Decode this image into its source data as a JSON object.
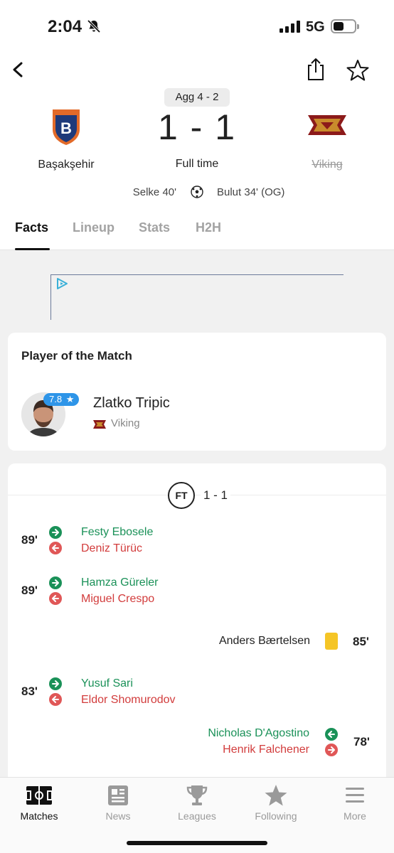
{
  "status_bar": {
    "time": "2:04",
    "network": "5G"
  },
  "header": {
    "aggregate": "Agg 4 - 2",
    "score": "1 - 1",
    "match_status": "Full time",
    "home_team": "Başakşehir",
    "away_team": "Viking",
    "home_scorer": "Selke 40'",
    "away_scorer": "Bulut 34' (OG)"
  },
  "tabs": [
    "Facts",
    "Lineup",
    "Stats",
    "H2H"
  ],
  "player_of_match": {
    "title": "Player of the Match",
    "rating": "7.8",
    "name": "Zlatko Tripic",
    "team": "Viking"
  },
  "events": {
    "ft_label": "FT",
    "ft_score": "1 - 1",
    "items": [
      {
        "minute": "89'",
        "in": "Festy Ebosele",
        "out": "Deniz Türüc"
      },
      {
        "minute": "89'",
        "in": "Hamza Güreler",
        "out": "Miguel Crespo"
      },
      {
        "minute": "85'",
        "card_player": "Anders Bærtelsen"
      },
      {
        "minute": "83'",
        "in": "Yusuf Sari",
        "out": "Eldor Shomurodov"
      },
      {
        "minute": "78'",
        "in": "Nicholas D'Agostino",
        "out": "Henrik Falchener"
      }
    ]
  },
  "bottom_nav": [
    "Matches",
    "News",
    "Leagues",
    "Following",
    "More"
  ],
  "colors": {
    "sub_in": "#1a9158",
    "sub_out": "#d23c3c",
    "rating": "#2e95e8",
    "yellow_card": "#f5c526"
  }
}
